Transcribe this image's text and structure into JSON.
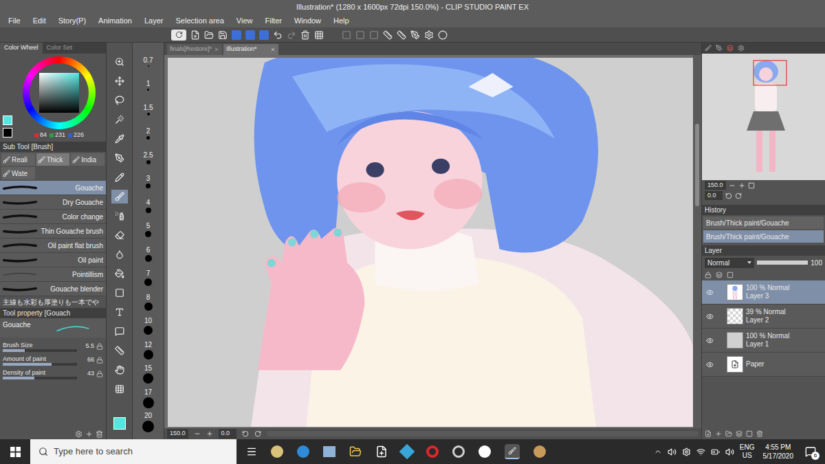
{
  "window": {
    "title": "Illustration* (1280 x 1600px 72dpi 150.0%) - CLIP STUDIO PAINT EX"
  },
  "menu": [
    "File",
    "Edit",
    "Story(P)",
    "Animation",
    "Layer",
    "Selection area",
    "View",
    "Filter",
    "Window",
    "Help"
  ],
  "color_panel": {
    "tabs": [
      {
        "label": "Color Wheel",
        "selected": true
      },
      {
        "label": "Color Set",
        "selected": false
      }
    ],
    "rgb": [
      "84",
      "231",
      "226"
    ],
    "color": "#54e7e2"
  },
  "sub_tool": {
    "title": "Sub Tool [Brush]",
    "groups": [
      {
        "label": "Reali",
        "selected": false
      },
      {
        "label": "Thick",
        "selected": true
      },
      {
        "label": "India",
        "selected": false
      },
      {
        "label": "Wate",
        "selected": false
      }
    ],
    "brushes": [
      {
        "label": "Gouache",
        "selected": true
      },
      {
        "label": "Dry Gouache",
        "selected": false
      },
      {
        "label": "Color change",
        "selected": false
      },
      {
        "label": "Thin Gouache brush",
        "selected": false
      },
      {
        "label": "Oil paint flat brush",
        "selected": false
      },
      {
        "label": "Oil paint",
        "selected": false
      },
      {
        "label": "Pointillism",
        "selected": false
      },
      {
        "label": "Gouache blender",
        "selected": false
      }
    ],
    "description": "主線も水彩も厚塗りも一本でや"
  },
  "tool_property": {
    "title": "Tool property [Gouach",
    "brush_name": "Gouache",
    "properties": [
      {
        "label": "Brush Size",
        "value": "5.5",
        "level": 0.3
      },
      {
        "label": "Amount of paint",
        "value": "66",
        "level": 0.66
      },
      {
        "label": "Density of paint",
        "value": "43",
        "level": 0.43
      }
    ]
  },
  "brush_sizes": [
    "0.7",
    "1",
    "1.5",
    "2",
    "2.5",
    "3",
    "4",
    "5",
    "6",
    "7",
    "8",
    "10",
    "12",
    "15",
    "17",
    "20"
  ],
  "canvas": {
    "tabs": [
      {
        "label": "finals[Restore]*",
        "selected": false
      },
      {
        "label": "Illustration*",
        "selected": true
      }
    ],
    "zoom": "150.0",
    "angle": "0.0"
  },
  "navigator": {
    "zoom": "150.0",
    "angle": "0.0"
  },
  "history": {
    "title": "History",
    "items": [
      {
        "label": "Brush/Thick paint/Gouache",
        "selected": false
      },
      {
        "label": "Brush/Thick paint/Gouache",
        "selected": true
      }
    ]
  },
  "layers": {
    "title": "Layer",
    "blend_mode": "Normal",
    "opacity": "100",
    "items": [
      {
        "info": "100 % Normal",
        "name": "Layer 3",
        "kind": "figure",
        "selected": true,
        "visible": true
      },
      {
        "info": "39 % Normal",
        "name": "Layer 2",
        "kind": "transparent",
        "selected": false,
        "visible": true
      },
      {
        "info": "100 % Normal",
        "name": "Layer 1",
        "kind": "fill",
        "selected": false,
        "visible": true
      },
      {
        "info": "",
        "name": "Paper",
        "kind": "paper",
        "selected": false,
        "visible": true
      }
    ]
  },
  "taskbar": {
    "search_placeholder": "Type here to search",
    "language": "ENG",
    "region": "US",
    "time": "4:55 PM",
    "date": "5/17/2020",
    "notifications": "6"
  }
}
